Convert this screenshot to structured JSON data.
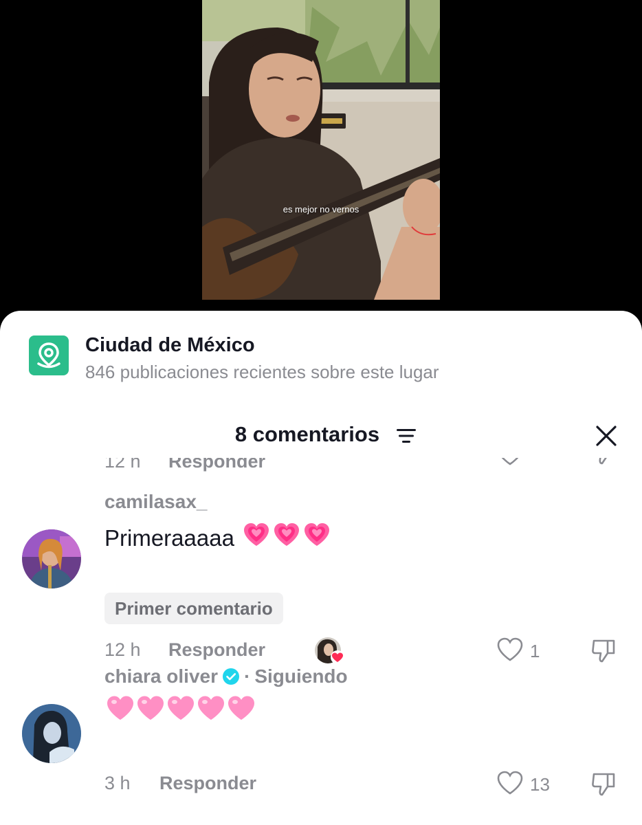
{
  "video": {
    "caption": "es mejor no vernos"
  },
  "location": {
    "icon": "location-pin-icon",
    "name": "Ciudad de México",
    "subtitle": "846 publicaciones recientes sobre este lugar"
  },
  "comments_header": {
    "title": "8 comentarios",
    "filter_icon": "filter-icon",
    "close_icon": "close-icon"
  },
  "partial_comment": {
    "time": "12 h",
    "reply_label": "Responder"
  },
  "comments": [
    {
      "username": "camilasax_",
      "text": "Primeraaaaa",
      "emoji": "💗💗💗",
      "badge": "Primer comentario",
      "time": "12 h",
      "reply_label": "Responder",
      "likes": "1",
      "liked_by_creator": true
    },
    {
      "username": "chiara oliver",
      "verified": true,
      "following": "Siguiendo",
      "text": "",
      "emoji": "🩷🩷🩷🩷🩷",
      "time": "3 h",
      "reply_label": "Responder",
      "likes": "13"
    }
  ],
  "colors": {
    "location_icon_bg": "#2bbd8b",
    "heart_pink": "#ff3d8b",
    "verified_blue": "#20d5ec",
    "text_primary": "#161823",
    "text_secondary": "#8a8b91"
  }
}
